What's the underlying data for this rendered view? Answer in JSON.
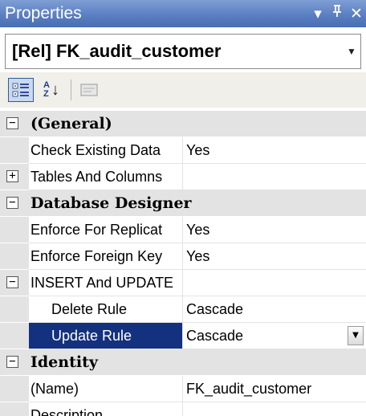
{
  "window": {
    "title": "Properties",
    "pin_glyph": "▾",
    "autohide_glyph": "ꟼ",
    "close_glyph": "✕"
  },
  "object_selector": {
    "value": "[Rel] FK_audit_customer",
    "arrow_glyph": "▼"
  },
  "toolbar": {
    "categorized_icon": "categorized-icon",
    "alphabetical_icon": "sort-az-icon",
    "alpha_top": "A",
    "alpha_bottom": "Z",
    "arrow_glyph": "↓",
    "property_pages_icon": "property-pages-icon"
  },
  "grid": {
    "general": {
      "label": "(General)",
      "toggle": "−",
      "check_existing": {
        "name": "Check Existing Data",
        "value": "Yes"
      },
      "tables_columns": {
        "name": "Tables And Columns",
        "value": "",
        "toggle": "+"
      }
    },
    "database_designer": {
      "label": "Database Designer",
      "toggle": "−",
      "enforce_replication": {
        "name": "Enforce For Replicat",
        "value": "Yes"
      },
      "enforce_foreign_key": {
        "name": "Enforce Foreign Key",
        "value": "Yes"
      },
      "insert_update": {
        "name": "INSERT And UPDATE",
        "value": "",
        "toggle": "−",
        "delete_rule": {
          "name": "Delete Rule",
          "value": "Cascade"
        },
        "update_rule": {
          "name": "Update Rule",
          "value": "Cascade",
          "dropdown_glyph": "▼"
        }
      }
    },
    "identity": {
      "label": "Identity",
      "toggle": "−",
      "name_prop": {
        "name": "(Name)",
        "value": "FK_audit_customer"
      },
      "description": {
        "name": "Description",
        "value": ""
      }
    }
  },
  "colors": {
    "titlebar": "#5b7fc2",
    "selection": "#14317f",
    "category_bg": "#e3e3e3"
  }
}
